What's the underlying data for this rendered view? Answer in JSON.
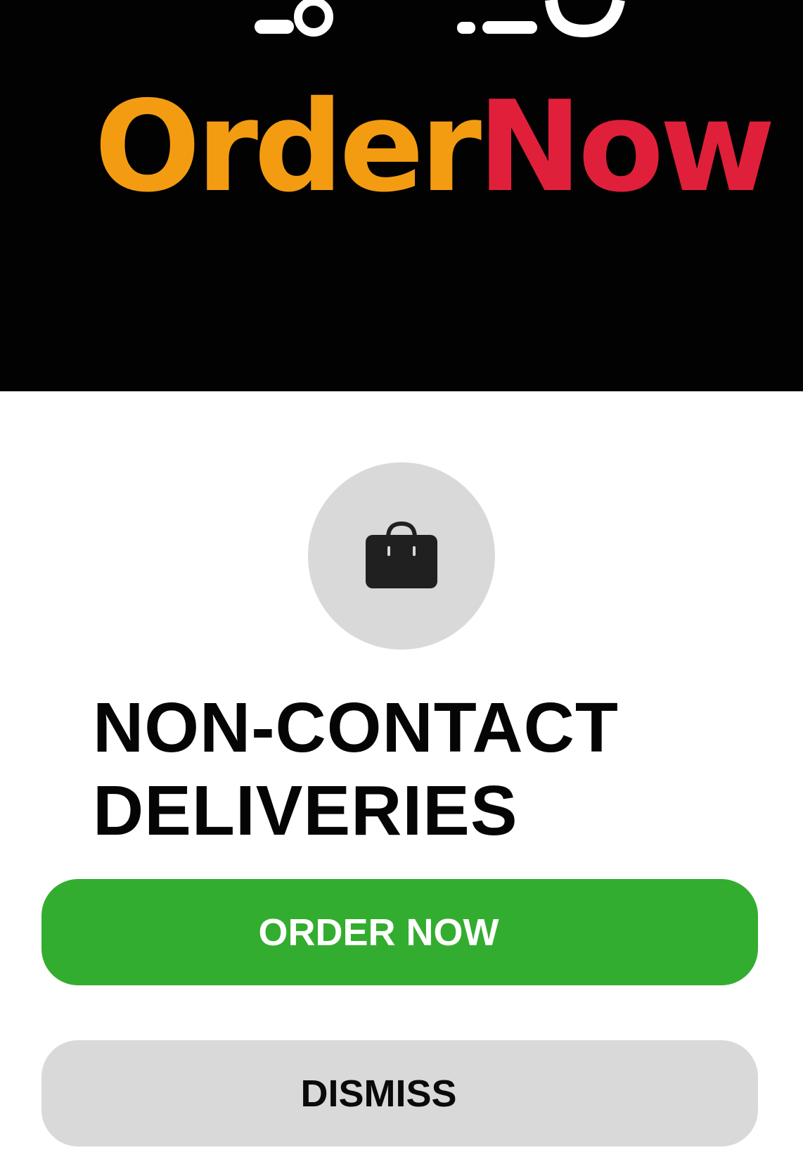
{
  "banner": {
    "logo_part_1": "Order",
    "logo_part_2": "Now"
  },
  "icons": {
    "center_icon": "shopping-bag-icon"
  },
  "promo": {
    "title_line_1": "NON-CONTACT",
    "title_line_2": "DELIVERIES"
  },
  "actions": {
    "primary_label": "ORDER NOW",
    "secondary_label": "DISMISS"
  },
  "colors": {
    "brand_orange": "#F39C12",
    "brand_red": "#E0203A",
    "accent_green": "#33AD2F",
    "neutral_gray": "#D9D9D9"
  }
}
